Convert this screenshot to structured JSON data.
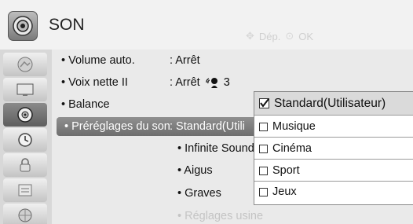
{
  "header": {
    "title": "SON",
    "nav_label": "Dép.",
    "ok_label": "OK"
  },
  "sidebar": {
    "items": [
      {
        "icon": "picture-icon"
      },
      {
        "icon": "screen-icon"
      },
      {
        "icon": "sound-icon",
        "active": true
      },
      {
        "icon": "time-icon"
      },
      {
        "icon": "lock-icon"
      },
      {
        "icon": "option-icon"
      },
      {
        "icon": "network-icon"
      }
    ]
  },
  "menu": {
    "volume_label": "• Volume auto.",
    "volume_value": ": Arrêt",
    "voix_label": "• Voix nette II",
    "voix_value": ": Arrêt",
    "voix_level": "3",
    "balance_label": "• Balance",
    "preset_label": "• Préréglages du son",
    "preset_value": ": Standard(Utili",
    "sub_items": [
      "• Infinite Sound",
      "• Aigus",
      "• Graves",
      "• Réglages usine"
    ]
  },
  "popup": {
    "options": [
      "Standard(Utilisateur)",
      "Musique",
      "Cinéma",
      "Sport",
      "Jeux"
    ],
    "selected_index": 0
  }
}
